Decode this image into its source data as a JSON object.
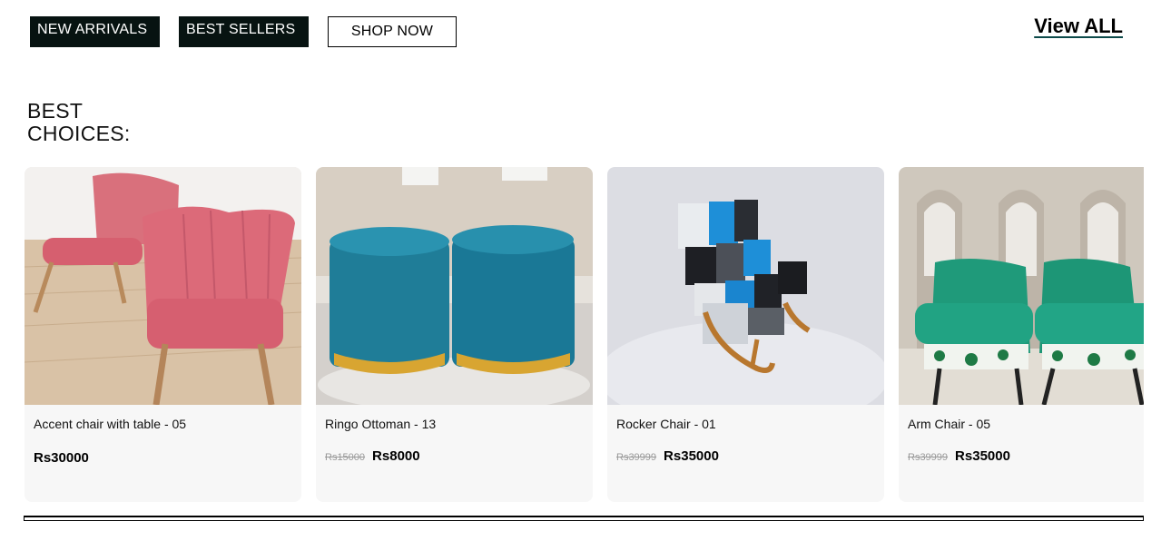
{
  "nav": {
    "new_arrivals": "NEW ARRIVALS",
    "best_sellers": "BEST SELLERS",
    "shop_now": "SHOP NOW",
    "view_all": "View ALL"
  },
  "section": {
    "title_line1": "BEST",
    "title_line2": "CHOICES:"
  },
  "products": [
    {
      "name": "Accent chair with table - 05",
      "old_price": "",
      "price": "Rs30000",
      "image_icon": "pink-accent-chair-icon"
    },
    {
      "name": "Ringo Ottoman - 13",
      "old_price": "Rs15000",
      "price": "Rs8000",
      "image_icon": "teal-ottoman-icon"
    },
    {
      "name": "Rocker Chair - 01",
      "old_price": "Rs39999",
      "price": "Rs35000",
      "image_icon": "patchwork-rocker-icon"
    },
    {
      "name": "Arm Chair - 05",
      "old_price": "Rs39999",
      "price": "Rs35000",
      "image_icon": "green-arm-chair-icon"
    }
  ],
  "colors": {
    "dark_button": "#071311",
    "view_all_underline": "#0c4a4a"
  }
}
